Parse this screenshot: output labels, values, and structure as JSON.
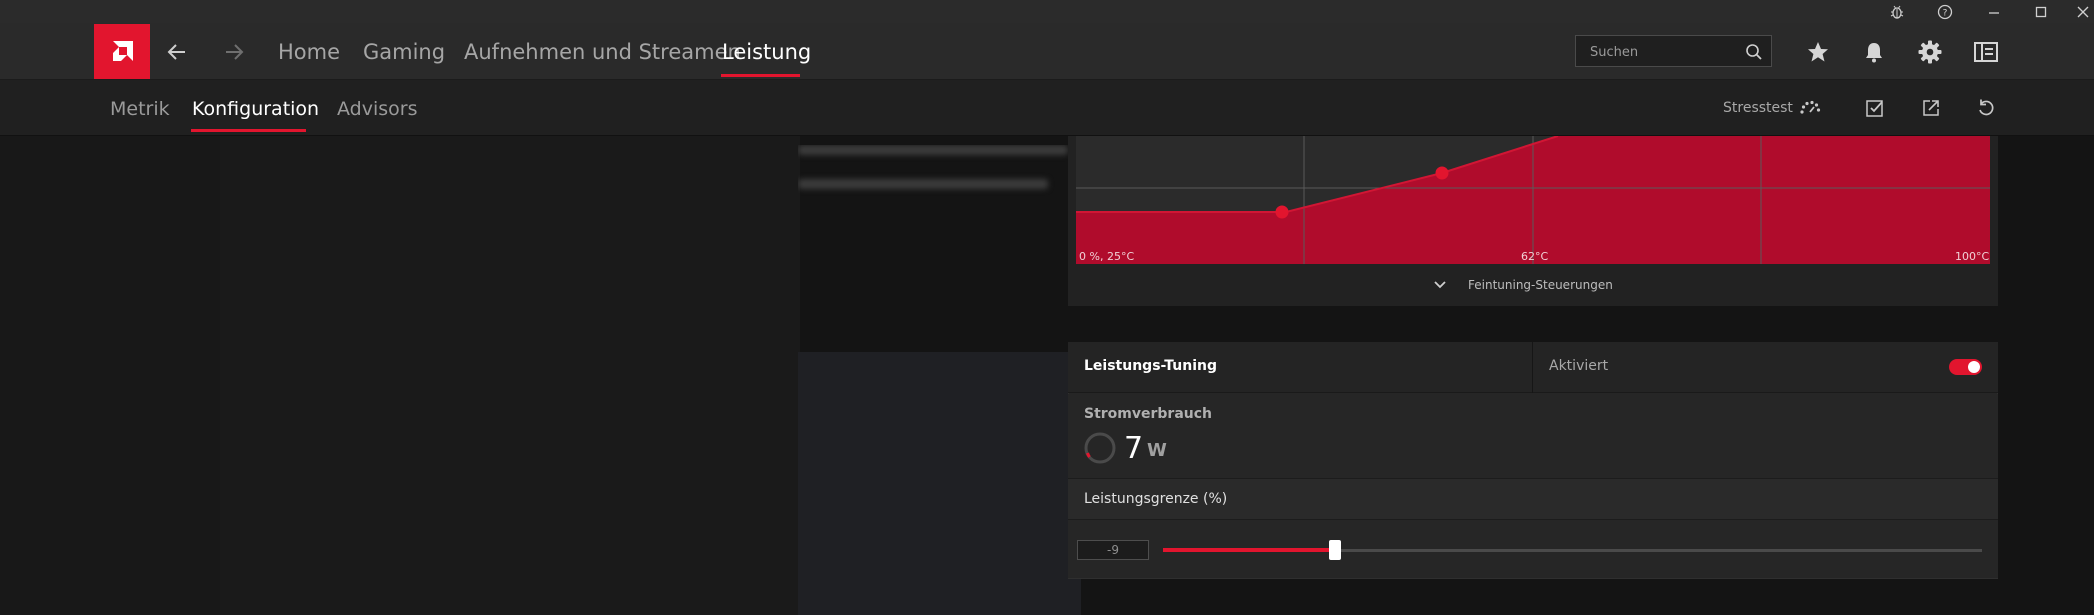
{
  "titlebar": {
    "icons": [
      "bug-icon",
      "help-icon",
      "minimize-icon",
      "maximize-icon",
      "close-icon"
    ]
  },
  "nav": {
    "items": [
      {
        "label": "Home"
      },
      {
        "label": "Gaming"
      },
      {
        "label": "Aufnehmen und Streamen"
      },
      {
        "label": "Leistung"
      }
    ],
    "active_index": 3,
    "search_placeholder": "Suchen",
    "icons": [
      "star-icon",
      "bell-icon",
      "gear-icon",
      "sidebar-toggle-icon"
    ]
  },
  "subnav": {
    "items": [
      {
        "label": "Metrik"
      },
      {
        "label": "Konfiguration"
      },
      {
        "label": "Advisors"
      }
    ],
    "active_index": 1,
    "stresstest_label": "Stresstest"
  },
  "fan_chart": {
    "label_start": "0 %, 25°C",
    "label_mid": "62°C",
    "label_end": "100°C",
    "fine_tune_label": "Feintuning-Steuerungen"
  },
  "tuning": {
    "title": "Leistungs-Tuning",
    "status": "Aktiviert",
    "enabled": true,
    "power_label": "Stromverbrauch",
    "power_value": "7",
    "power_unit": "W",
    "limit_label": "Leistungsgrenze (%)",
    "limit_value": "-9",
    "limit_fraction": 0.21
  },
  "colors": {
    "accent": "#e2152e",
    "chart_fill": "#b00c2c",
    "background": "#141414"
  }
}
